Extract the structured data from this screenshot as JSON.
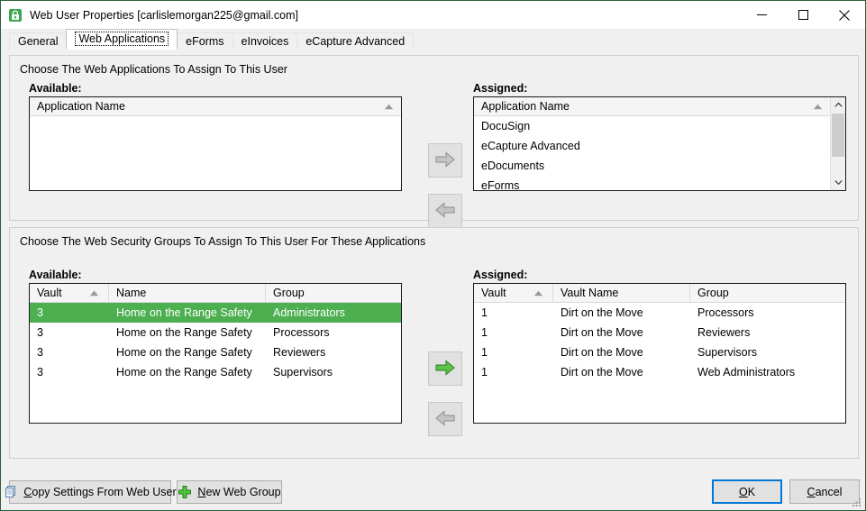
{
  "window": {
    "title": "Web User Properties [carlislemorgan225@gmail.com]",
    "icon": "lock-user-icon",
    "controls": {
      "minimize": "minimize-icon",
      "maximize": "maximize-icon",
      "close": "close-icon"
    }
  },
  "tabs": [
    {
      "label": "General",
      "active": false
    },
    {
      "label": "Web Applications",
      "active": true
    },
    {
      "label": "eForms",
      "active": false
    },
    {
      "label": "eInvoices",
      "active": false
    },
    {
      "label": "eCapture Advanced",
      "active": false
    }
  ],
  "applications_panel": {
    "caption": "Choose The Web Applications To Assign To This User",
    "available": {
      "label": "Available:",
      "column_header": "Application Name",
      "sort_indicator": "sort-ascending-icon",
      "rows": []
    },
    "assigned": {
      "label": "Assigned:",
      "column_header": "Application Name",
      "sort_indicator": "sort-ascending-icon",
      "rows": [
        "DocuSign",
        "eCapture Advanced",
        "eDocuments",
        "eForms"
      ],
      "scrollbar": {
        "up": "scroll-up-icon",
        "down": "scroll-down-icon"
      }
    },
    "assign_button": {
      "name": "assign-application-button",
      "icon": "arrow-right-icon",
      "enabled": false
    },
    "unassign_button": {
      "name": "unassign-application-button",
      "icon": "arrow-left-icon",
      "enabled": false
    }
  },
  "groups_panel": {
    "caption": "Choose The Web Security Groups To Assign To This User For These Applications",
    "available": {
      "label": "Available:",
      "columns": [
        "Vault",
        "Name",
        "Group"
      ],
      "sort_indicator": "sort-ascending-icon",
      "rows": [
        {
          "vault": "3",
          "name": "Home on the Range Safety",
          "group": "Administrators",
          "selected": true
        },
        {
          "vault": "3",
          "name": "Home on the Range Safety",
          "group": "Processors",
          "selected": false
        },
        {
          "vault": "3",
          "name": "Home on the Range Safety",
          "group": "Reviewers",
          "selected": false
        },
        {
          "vault": "3",
          "name": "Home on the Range Safety",
          "group": "Supervisors",
          "selected": false
        }
      ]
    },
    "assigned": {
      "label": "Assigned:",
      "columns": [
        "Vault",
        "Vault Name",
        "Group"
      ],
      "sort_indicator": "sort-ascending-icon",
      "rows": [
        {
          "vault": "1",
          "name": "Dirt on the Move",
          "group": "Processors",
          "selected": false
        },
        {
          "vault": "1",
          "name": "Dirt on the Move",
          "group": "Reviewers",
          "selected": false
        },
        {
          "vault": "1",
          "name": "Dirt on the Move",
          "group": "Supervisors",
          "selected": false
        },
        {
          "vault": "1",
          "name": "Dirt on the Move",
          "group": "Web Administrators",
          "selected": false
        }
      ]
    },
    "assign_button": {
      "name": "assign-group-button",
      "icon": "arrow-right-icon",
      "enabled": true
    },
    "unassign_button": {
      "name": "unassign-group-button",
      "icon": "arrow-left-icon",
      "enabled": false
    }
  },
  "bottom_bar": {
    "copy_settings": {
      "label": "Copy Settings From Web User",
      "accel": "C",
      "icon": "copy-icon"
    },
    "new_web_group": {
      "label": "New Web Group",
      "accel": "N",
      "icon": "plus-icon"
    },
    "ok": {
      "label": "OK",
      "accel": "O",
      "default": true
    },
    "cancel": {
      "label": "Cancel",
      "accel": "C"
    },
    "resize_grip": "resize-grip-icon"
  },
  "colors": {
    "selection_green": "#4caf50",
    "accent_blue": "#0078d7",
    "enabled_arrow_green": "#5cc24a",
    "disabled_arrow_gray": "#b4b4b4",
    "window_border": "#2f5d38"
  }
}
